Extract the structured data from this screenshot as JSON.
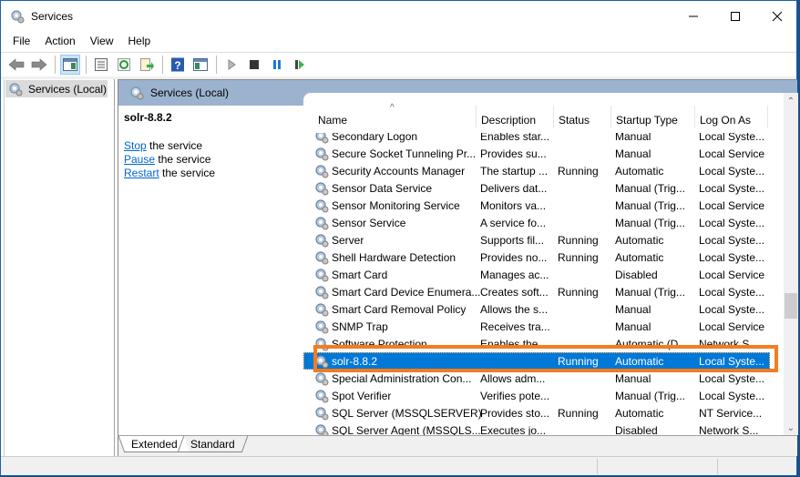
{
  "window": {
    "title": "Services",
    "controls": {
      "minimize": "minimize",
      "maximize": "maximize",
      "close": "close"
    }
  },
  "menu": [
    "File",
    "Action",
    "View",
    "Help"
  ],
  "toolbar": {
    "buttons": [
      {
        "name": "back",
        "icon": "back-arrow-icon"
      },
      {
        "name": "forward",
        "icon": "forward-arrow-icon"
      },
      {
        "name": "show-hide-console-tree",
        "icon": "console-tree-icon",
        "active": true
      },
      {
        "name": "properties",
        "icon": "properties-icon"
      },
      {
        "name": "refresh",
        "icon": "refresh-icon"
      },
      {
        "name": "export-list",
        "icon": "export-icon"
      },
      {
        "name": "help",
        "icon": "help-icon"
      },
      {
        "name": "show-hide-action-pane",
        "icon": "action-pane-icon"
      },
      {
        "name": "start-service",
        "icon": "play-icon"
      },
      {
        "name": "stop-service",
        "icon": "stop-icon"
      },
      {
        "name": "pause-service",
        "icon": "pause-icon"
      },
      {
        "name": "restart-service",
        "icon": "restart-icon"
      }
    ]
  },
  "tree": {
    "selected": "Services (Local)"
  },
  "panel": {
    "header": "Services (Local)",
    "detail": {
      "service_name": "solr-8.8.2",
      "actions": [
        {
          "link": "Stop",
          "rest": " the service"
        },
        {
          "link": "Pause",
          "rest": " the service"
        },
        {
          "link": "Restart",
          "rest": " the service"
        }
      ]
    },
    "columns": [
      "Name",
      "Description",
      "Status",
      "Startup Type",
      "Log On As"
    ],
    "sorted_column": "Name",
    "rows": [
      {
        "name": "Secondary Logon",
        "description": "Enables star...",
        "status": "",
        "startup": "Manual",
        "logon": "Local Syste..."
      },
      {
        "name": "Secure Socket Tunneling Pr...",
        "description": "Provides su...",
        "status": "",
        "startup": "Manual",
        "logon": "Local Service"
      },
      {
        "name": "Security Accounts Manager",
        "description": "The startup ...",
        "status": "Running",
        "startup": "Automatic",
        "logon": "Local Syste..."
      },
      {
        "name": "Sensor Data Service",
        "description": "Delivers dat...",
        "status": "",
        "startup": "Manual (Trig...",
        "logon": "Local Syste..."
      },
      {
        "name": "Sensor Monitoring Service",
        "description": "Monitors va...",
        "status": "",
        "startup": "Manual (Trig...",
        "logon": "Local Service"
      },
      {
        "name": "Sensor Service",
        "description": "A service fo...",
        "status": "",
        "startup": "Manual (Trig...",
        "logon": "Local Syste..."
      },
      {
        "name": "Server",
        "description": "Supports fil...",
        "status": "Running",
        "startup": "Automatic",
        "logon": "Local Syste..."
      },
      {
        "name": "Shell Hardware Detection",
        "description": "Provides no...",
        "status": "Running",
        "startup": "Automatic",
        "logon": "Local Syste..."
      },
      {
        "name": "Smart Card",
        "description": "Manages ac...",
        "status": "",
        "startup": "Disabled",
        "logon": "Local Service"
      },
      {
        "name": "Smart Card Device Enumera...",
        "description": "Creates soft...",
        "status": "Running",
        "startup": "Manual (Trig...",
        "logon": "Local Syste..."
      },
      {
        "name": "Smart Card Removal Policy",
        "description": "Allows the s...",
        "status": "",
        "startup": "Manual",
        "logon": "Local Syste..."
      },
      {
        "name": "SNMP Trap",
        "description": "Receives tra...",
        "status": "",
        "startup": "Manual",
        "logon": "Local Service"
      },
      {
        "name": "Software Protection",
        "description": "Enables the ...",
        "status": "",
        "startup": "Automatic (D...",
        "logon": "Network S..."
      },
      {
        "name": "solr-8.8.2",
        "description": "",
        "status": "Running",
        "startup": "Automatic",
        "logon": "Local Syste...",
        "selected": true
      },
      {
        "name": "Special Administration Con...",
        "description": "Allows adm...",
        "status": "",
        "startup": "Manual",
        "logon": "Local Syste..."
      },
      {
        "name": "Spot Verifier",
        "description": "Verifies pote...",
        "status": "",
        "startup": "Manual (Trig...",
        "logon": "Local Syste..."
      },
      {
        "name": "SQL Server (MSSQLSERVER)",
        "description": "Provides sto...",
        "status": "Running",
        "startup": "Automatic",
        "logon": "NT Service..."
      },
      {
        "name": "SQL Server Agent (MSSQLS...",
        "description": "Executes jo...",
        "status": "",
        "startup": "Disabled",
        "logon": "Network S..."
      }
    ],
    "tabs": [
      "Extended",
      "Standard"
    ],
    "active_tab": "Extended"
  },
  "colors": {
    "selection": "#0078d7",
    "highlight_box": "#f47c20",
    "panel_header": "#9cb3cf",
    "link": "#0066cc"
  }
}
